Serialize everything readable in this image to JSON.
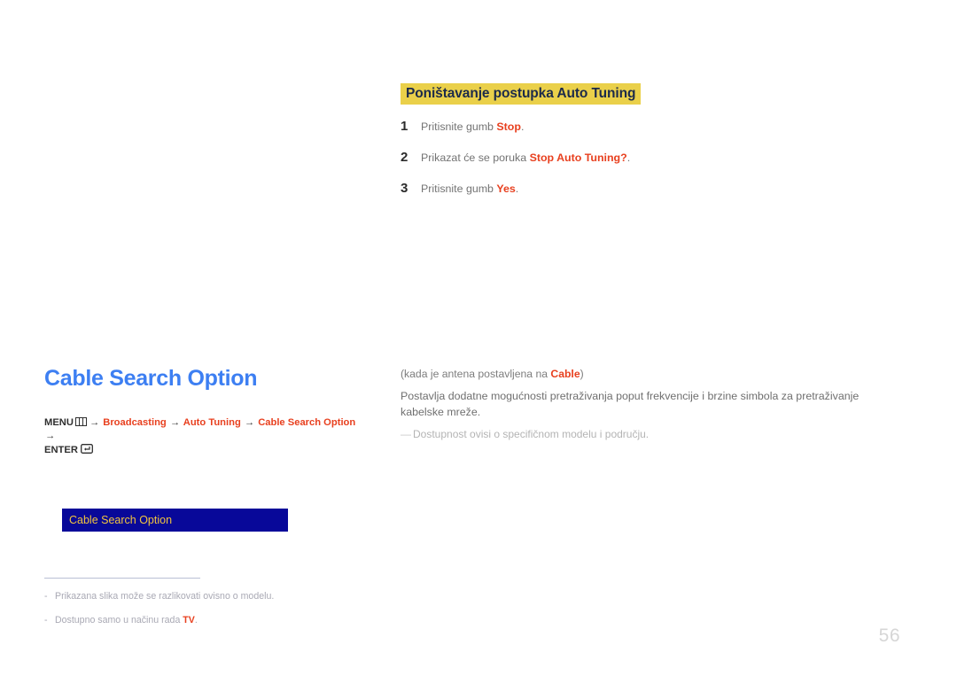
{
  "top_section": {
    "heading": "Poništavanje postupka Auto Tuning",
    "steps": [
      {
        "number": "1",
        "prefix": "Pritisnite gumb ",
        "keyword": "Stop",
        "suffix": "."
      },
      {
        "number": "2",
        "prefix": "Prikazat će se poruka ",
        "keyword": "Stop Auto Tuning?",
        "suffix": "."
      },
      {
        "number": "3",
        "prefix": "Pritisnite gumb ",
        "keyword": "Yes",
        "suffix": "."
      }
    ]
  },
  "description": {
    "condition_prefix": "(kada je antena postavljena na ",
    "condition_keyword": "Cable",
    "condition_suffix": ")",
    "main_text": "Postavlja dodatne mogućnosti pretraživanja poput frekvencije i brzine simbola za pretraživanje kabelske mreže.",
    "availability_dash": "—",
    "availability_text": "Dostupnost ovisi o specifičnom modelu i području."
  },
  "left_column": {
    "title": "Cable Search Option",
    "breadcrumb": {
      "menu_label": "MENU",
      "menu_icon": "menu-grid-icon",
      "arrow": "→",
      "crumbs": [
        "Broadcasting",
        "Auto Tuning",
        "Cable Search Option"
      ],
      "enter_label": "ENTER",
      "enter_icon": "enter-key-icon"
    },
    "menu_box": {
      "label": "Cable Search Option"
    }
  },
  "footnotes": [
    {
      "dash": "-",
      "text": "Prikazana slika može se razlikovati ovisno o modelu.",
      "badge": "",
      "suffix": ""
    },
    {
      "dash": "-",
      "text": "Dostupno samo u načinu rada ",
      "badge": "TV",
      "suffix": "."
    }
  ],
  "page_number": "56",
  "colors": {
    "heading_highlight": "#ead04a",
    "heading_text": "#1c2a4a",
    "keyword_orange": "#e8401f",
    "title_blue": "#3d7ff2",
    "menu_box_bg": "#080899",
    "menu_box_text": "#f2c53d",
    "body_gray": "#737373",
    "muted_gray": "#b4b4b4",
    "page_number_gray": "#d6d6d6"
  }
}
